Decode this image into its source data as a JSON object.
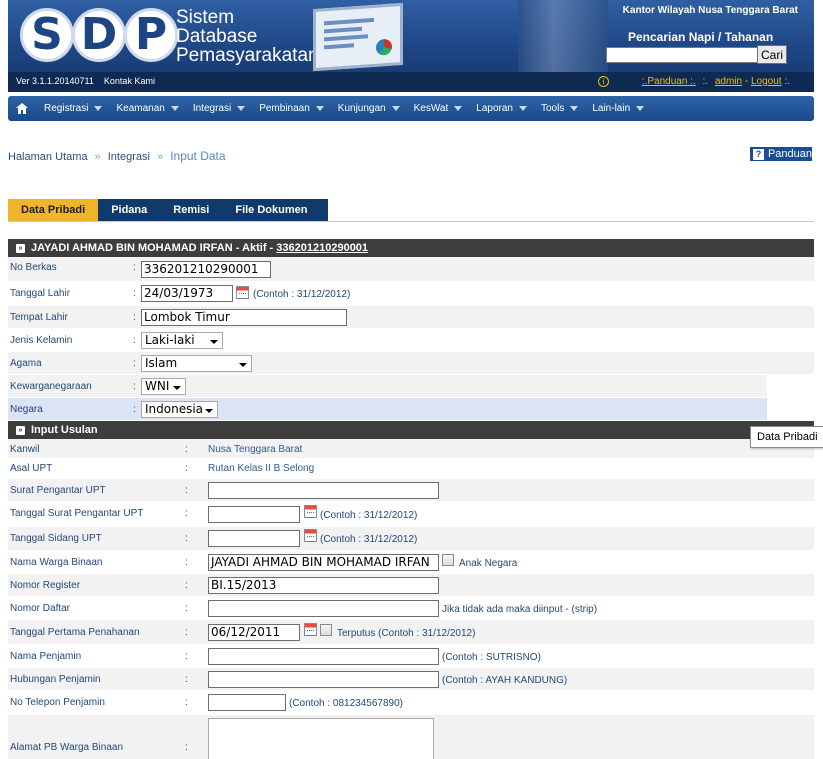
{
  "header": {
    "logo_letters": [
      "S",
      "D",
      "P"
    ],
    "app_title_lines": [
      "Sistem",
      "Database",
      "Pemasyarakatan"
    ],
    "version": "Ver 3.1.1.20140711",
    "contact": "Kontak Kami",
    "kantor": "Kantor Wilayah Nusa Tenggara Barat",
    "search_title": "Pencarian Napi / Tahanan",
    "search_value": "",
    "search_button": "Cari",
    "panduan_link": ":.Panduan :.",
    "admin_link": "admin",
    "logout_link": "Logout",
    "sep_dot": ":.",
    "sep_dash": "-",
    "sep_end": ":."
  },
  "nav": {
    "home_icon": "home-icon",
    "items": [
      "Registrasi",
      "Keamanan",
      "Integrasi",
      "Pembinaan",
      "Kunjungan",
      "KesWat",
      "Laporan",
      "Tools",
      "Lain-lain"
    ]
  },
  "breadcrumb": {
    "items": [
      "Halaman Utama",
      "Integrasi"
    ],
    "separator": "»",
    "current": "Input Data",
    "panduan_button": "Panduan"
  },
  "tabs": [
    "Data Pribadi",
    "Pidana",
    "Remisi",
    "File Dokumen"
  ],
  "personal": {
    "header_prefix": "JAYADI AHMAD BIN MOHAMAD IRFAN - Aktif - ",
    "header_id": "336201210290001",
    "colon": ":",
    "fields": {
      "no_berkas": {
        "label": "No Berkas",
        "value": "336201210290001"
      },
      "tanggal_lahir": {
        "label": "Tanggal Lahir",
        "value": "24/03/1973",
        "hint": "(Contoh : 31/12/2012)"
      },
      "tempat_lahir": {
        "label": "Tempat Lahir",
        "value": "Lombok Timur"
      },
      "jenis_kelamin": {
        "label": "Jenis Kelamin",
        "value": "Laki-laki"
      },
      "agama": {
        "label": "Agama",
        "value": "Islam"
      },
      "kewarganegaraan": {
        "label": "Kewarganegaraan",
        "value": "WNI"
      },
      "negara": {
        "label": "Negara",
        "value": "Indonesia"
      }
    }
  },
  "usulan": {
    "header": "Input Usulan",
    "fields": {
      "kanwil": {
        "label": "Kanwil",
        "value": "Nusa Tenggara Barat"
      },
      "asal_upt": {
        "label": "Asal UPT",
        "value": "Rutan Kelas II B Selong"
      },
      "surat_pengantar": {
        "label": "Surat Pengantar UPT",
        "value": ""
      },
      "tanggal_surat": {
        "label": "Tanggal Surat Pengantar UPT",
        "value": "",
        "hint": "(Contoh : 31/12/2012)"
      },
      "tanggal_sidang": {
        "label": "Tanggal Sidang UPT",
        "value": "",
        "hint": "(Contoh : 31/12/2012)"
      },
      "nama_warga": {
        "label": "Nama Warga Binaan",
        "value": "JAYADI AHMAD BIN MOHAMAD IRFAN",
        "checkbox_label": "Anak Negara"
      },
      "nomor_register": {
        "label": "Nomor Register",
        "value": "BI.15/2013"
      },
      "nomor_daftar": {
        "label": "Nomor Daftar",
        "value": "",
        "hint": "Jika tidak ada maka diinput - (strip)"
      },
      "tanggal_penahanan": {
        "label": "Tanggal Pertama Penahanan",
        "value": "06/12/2011",
        "hint": "Terputus (Contoh : 31/12/2012)"
      },
      "nama_penjamin": {
        "label": "Nama Penjamin",
        "value": "",
        "hint": "(Contoh : SUTRISNO)"
      },
      "hubungan_penjamin": {
        "label": "Hubungan Penjamin",
        "value": "",
        "hint": "(Contoh : AYAH KANDUNG)"
      },
      "telepon_penjamin": {
        "label": "No Telepon Penjamin",
        "value": "",
        "hint": "(Contoh : 081234567890)"
      },
      "alamat_pb": {
        "label": "Alamat PB Warga Binaan",
        "value": ""
      }
    }
  },
  "tooltip": "Data Pribadi",
  "colors": {
    "header_bg": "#1d4584",
    "nav_bg": "#2e64a8",
    "tab_active": "#f1b52b",
    "tab_bar": "#103a6c",
    "section_header": "#3d3d3d",
    "row_odd": "#f2f2f2",
    "row_even": "#ffffff",
    "row_highlight": "#dbe3f7",
    "link_yellow": "#f0c000"
  }
}
